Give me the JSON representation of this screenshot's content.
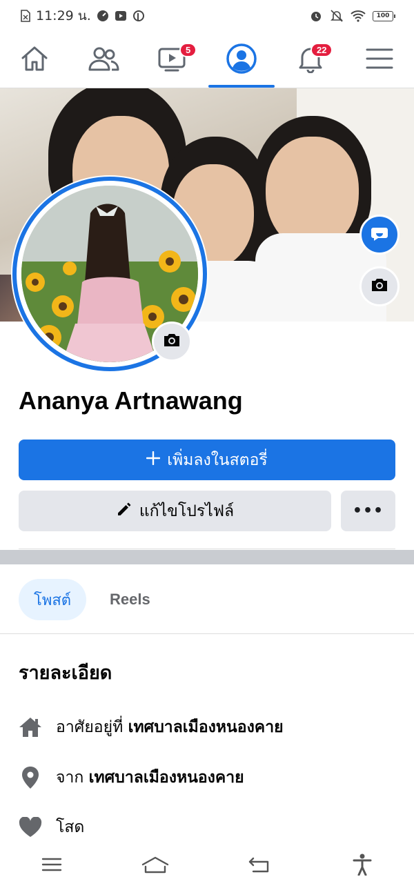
{
  "status_bar": {
    "time": "11:29 น.",
    "battery": "100"
  },
  "nav": {
    "tabs": [
      {
        "name": "home",
        "icon": "home-icon"
      },
      {
        "name": "friends",
        "icon": "friends-icon"
      },
      {
        "name": "watch",
        "icon": "video-icon",
        "badge": "5"
      },
      {
        "name": "profile",
        "icon": "profile-icon",
        "active": true
      },
      {
        "name": "notifications",
        "icon": "bell-icon",
        "badge": "22"
      },
      {
        "name": "menu",
        "icon": "menu-icon"
      }
    ]
  },
  "profile": {
    "name": "Ananya Artnawang"
  },
  "actions": {
    "add_story_label": "เพิ่มลงในสตอรี่",
    "edit_profile_label": "แก้ไขโปรไฟล์",
    "more_label": "•••"
  },
  "tabs": {
    "posts": "โพสต์",
    "reels": "Reels"
  },
  "details": {
    "title": "รายละเอียด",
    "lives_in_prefix": "อาศัยอยู่ที่",
    "lives_in_value": "เทศบาลเมืองหนองคาย",
    "from_prefix": "จาก",
    "from_value": "เทศบาลเมืองหนองคาย",
    "relationship": "โสด"
  },
  "colors": {
    "accent": "#1b74e4",
    "badge": "#e41e3f",
    "button_gray": "#e4e6eb"
  }
}
